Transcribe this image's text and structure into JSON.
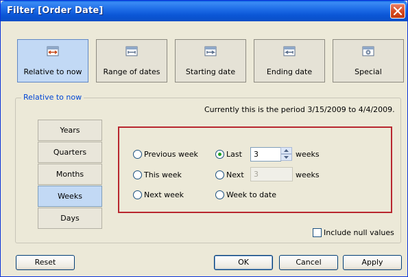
{
  "window": {
    "title": "Filter [Order Date]"
  },
  "modes": [
    {
      "label": "Relative to now",
      "icon": "calendar-relative-icon",
      "selected": true
    },
    {
      "label": "Range of dates",
      "icon": "calendar-range-icon",
      "selected": false
    },
    {
      "label": "Starting date",
      "icon": "calendar-start-icon",
      "selected": false
    },
    {
      "label": "Ending date",
      "icon": "calendar-end-icon",
      "selected": false
    },
    {
      "label": "Special",
      "icon": "calendar-special-icon",
      "selected": false
    }
  ],
  "group": {
    "legend": "Relative to now",
    "period_text": "Currently this is the period 3/15/2009 to 4/4/2009."
  },
  "side_tabs": [
    {
      "label": "Years",
      "selected": false
    },
    {
      "label": "Quarters",
      "selected": false
    },
    {
      "label": "Months",
      "selected": false
    },
    {
      "label": "Weeks",
      "selected": true
    },
    {
      "label": "Days",
      "selected": false
    }
  ],
  "options": {
    "previous": "Previous week",
    "this": "This week",
    "next": "Next week",
    "last": "Last",
    "next_n": "Next",
    "to_date": "Week to date",
    "last_value": "3",
    "next_value": "3",
    "unit": "weeks",
    "selected": "last"
  },
  "include_null": {
    "label": "Include null values",
    "checked": false
  },
  "buttons": {
    "reset": "Reset",
    "ok": "OK",
    "cancel": "Cancel",
    "apply": "Apply"
  },
  "colors": {
    "title_bar": "#0b56d6",
    "selected_bg": "#c2d9f5",
    "highlight_border": "#b8262e",
    "legend_text": "#0046d5"
  }
}
